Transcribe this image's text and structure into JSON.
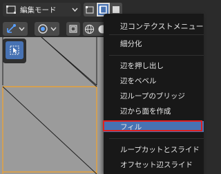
{
  "header": {
    "mode_label": "編集モード",
    "mode_icon": "edit-mode-icon",
    "select_modes": [
      "vertex-select-icon",
      "edge-select-icon",
      "face-select-icon"
    ],
    "active_select_mode": "edge"
  },
  "toolbar": {
    "transform_pivot_icon": "transform-orientation-icon",
    "snap_icon": "snap-icon",
    "overlay_icon": "overlay-icon",
    "shading_icons": [
      "wireframe-icon",
      "solid-icon"
    ]
  },
  "tool": {
    "active_tool_icon": "select-cursor-icon"
  },
  "context_menu": {
    "title": "辺コンテクストメニュー",
    "items": [
      "細分化",
      "辺を押し出し",
      "辺をベベル",
      "辺ループのブリッジ",
      "辺から面を作成",
      "フィル",
      "ループカットとスライド",
      "オフセット辺スライド"
    ],
    "highlighted_item": "フィル"
  },
  "colors": {
    "accent": "#4772b3",
    "highlight_border": "#e02020",
    "viewport_bg": "#9b9b9b",
    "selected_edge": "#e8a23a",
    "menu_bg": "#181818"
  }
}
